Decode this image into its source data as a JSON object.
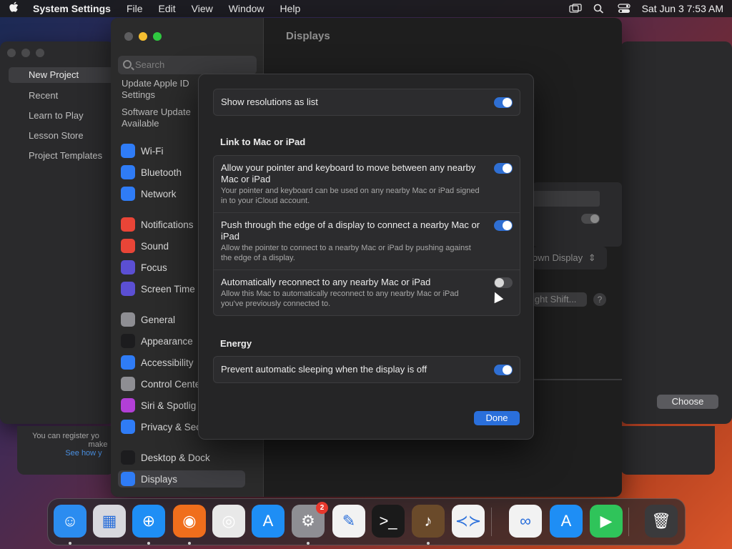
{
  "menubar": {
    "app_name": "System Settings",
    "menus": [
      "File",
      "Edit",
      "View",
      "Window",
      "Help"
    ],
    "clock": "Sat Jun 3  7:53 AM"
  },
  "bg_window": {
    "items": [
      "New Project",
      "Recent",
      "Learn to Play",
      "Lesson Store",
      "Project Templates"
    ],
    "footer_text": "You can register yo",
    "footer_text2": "make",
    "footer_link": "See how y",
    "choose_label": "Choose"
  },
  "settings": {
    "search_placeholder": "Search",
    "update_items": [
      "Update Apple ID Settings",
      "Software Update Available"
    ],
    "groups": [
      [
        {
          "label": "Wi-Fi",
          "icon": "wifi-icon",
          "color": "#2f7cf6"
        },
        {
          "label": "Bluetooth",
          "icon": "bluetooth-icon",
          "color": "#2f7cf6"
        },
        {
          "label": "Network",
          "icon": "network-icon",
          "color": "#2f7cf6"
        }
      ],
      [
        {
          "label": "Notifications",
          "icon": "notifications-icon",
          "color": "#e94537"
        },
        {
          "label": "Sound",
          "icon": "sound-icon",
          "color": "#e94537"
        },
        {
          "label": "Focus",
          "icon": "focus-icon",
          "color": "#5b4fd3"
        },
        {
          "label": "Screen Time",
          "icon": "screen-time-icon",
          "color": "#5b4fd3"
        }
      ],
      [
        {
          "label": "General",
          "icon": "general-icon",
          "color": "#8e8e93"
        },
        {
          "label": "Appearance",
          "icon": "appearance-icon",
          "color": "#1c1c1e"
        },
        {
          "label": "Accessibility",
          "icon": "accessibility-icon",
          "color": "#2f7cf6"
        },
        {
          "label": "Control Cente",
          "icon": "control-center-icon",
          "color": "#8e8e93"
        },
        {
          "label": "Siri & Spotlig",
          "icon": "siri-icon",
          "color": "#b23fd6"
        },
        {
          "label": "Privacy & Sec",
          "icon": "privacy-icon",
          "color": "#2f7cf6"
        }
      ],
      [
        {
          "label": "Desktop & Dock",
          "icon": "desktop-dock-icon",
          "color": "#1c1c1e"
        },
        {
          "label": "Displays",
          "icon": "displays-icon",
          "color": "#2f7cf6"
        }
      ]
    ],
    "content_title": "Displays",
    "content_dropdown": "own Display",
    "content_button": "ight Shift...",
    "content_help": "?"
  },
  "modal": {
    "show_resolutions": {
      "label": "Show resolutions as list",
      "on": true
    },
    "link_header": "Link to Mac or iPad",
    "link_rows": [
      {
        "title": "Allow your pointer and keyboard to move between any nearby Mac or iPad",
        "desc": "Your pointer and keyboard can be used on any nearby Mac or iPad signed in to your iCloud account.",
        "on": true
      },
      {
        "title": "Push through the edge of a display to connect a nearby Mac or iPad",
        "desc": "Allow the pointer to connect to a nearby Mac or iPad by pushing against the edge of a display.",
        "on": true
      },
      {
        "title": "Automatically reconnect to any nearby Mac or iPad",
        "desc": "Allow this Mac to automatically reconnect to any nearby Mac or iPad you've previously connected to.",
        "on": false
      }
    ],
    "energy_header": "Energy",
    "prevent_sleep": {
      "label": "Prevent automatic sleeping when the display is off",
      "on": true
    },
    "done_label": "Done"
  },
  "dock": {
    "apps": [
      {
        "name": "finder",
        "glyph": "☺",
        "color": "#2b8cf0",
        "running": true
      },
      {
        "name": "launchpad",
        "glyph": "▦",
        "color": "#d8d8de",
        "running": false
      },
      {
        "name": "safari",
        "glyph": "⊕",
        "color": "#1e8ef5",
        "running": true
      },
      {
        "name": "firefox",
        "glyph": "◉",
        "color": "#f06e1c",
        "running": true
      },
      {
        "name": "chrome",
        "glyph": "◎",
        "color": "#e8e8e8",
        "running": false
      },
      {
        "name": "app-store",
        "glyph": "A",
        "color": "#1e8ef5",
        "running": false
      },
      {
        "name": "system-settings",
        "glyph": "⚙",
        "color": "#8e8e93",
        "running": true,
        "badge": "2"
      },
      {
        "name": "textedit",
        "glyph": "✎",
        "color": "#f2f2f2",
        "running": false
      },
      {
        "name": "terminal",
        "glyph": ">_",
        "color": "#1a1a1a",
        "running": false
      },
      {
        "name": "garageband",
        "glyph": "♪",
        "color": "#6a4a2a",
        "running": true
      },
      {
        "name": "vscode",
        "glyph": "≺≻",
        "color": "#f2f2f2",
        "running": false
      },
      {
        "name": "visual-studio",
        "glyph": "∞",
        "color": "#f2f2f2",
        "running": false
      },
      {
        "name": "xcode-store",
        "glyph": "A",
        "color": "#1e8ef5",
        "running": false
      },
      {
        "name": "facetime",
        "glyph": "▶",
        "color": "#2fc45a",
        "running": false
      },
      {
        "name": "trash",
        "glyph": "🗑",
        "color": "#3a3a3c",
        "running": false
      }
    ]
  }
}
